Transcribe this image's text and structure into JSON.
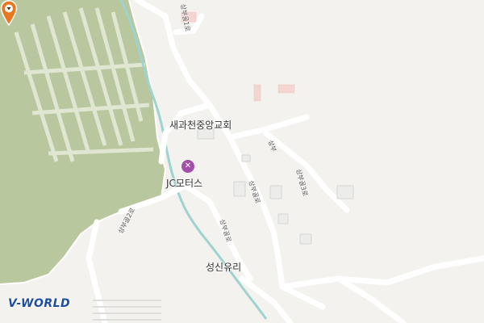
{
  "map": {
    "background": "#f3f2ef",
    "park_color": "#b8c79d",
    "stream_color": "#9fd3cf",
    "road_color": "#ffffff",
    "building_color": "#f5d5d2"
  },
  "pois": {
    "church": "새과천중앙교회",
    "motors": "JC모터스",
    "glass": "성신유리"
  },
  "roads": {
    "top": "상부골1로",
    "upper_right_1": "상부",
    "upper_right_2": "상부골3로",
    "center": "상부골로",
    "lower": "상부골로",
    "left": "상부골2로"
  },
  "icons": {
    "poi": "wrench-screwdriver-icon",
    "marker": "map-pin-icon"
  },
  "logo": "V-WORLD"
}
